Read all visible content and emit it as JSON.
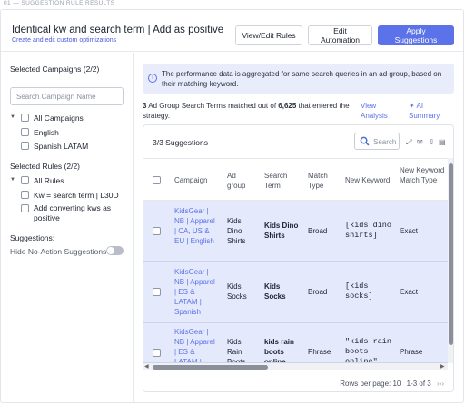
{
  "breadcrumb": "01 — SUGGESTION RULE RESULTS",
  "header": {
    "title": "Identical kw and search term | Add as positive",
    "subtitle": "Create and edit custom optimizations",
    "buttons": {
      "view_edit_rules": "View/Edit Rules",
      "edit_automation": "Edit Automation",
      "apply_suggestions": "Apply Suggestions"
    }
  },
  "sidebar": {
    "campaigns_heading": "Selected Campaigns (2/2)",
    "campaign_search_placeholder": "Search Campaign Name",
    "all_campaigns": "All Campaigns",
    "campaigns": [
      "English",
      "Spanish LATAM"
    ],
    "rules_heading": "Selected Rules (2/2)",
    "all_rules": "All Rules",
    "rules": [
      "Kw = search term | L30D",
      "Add converting kws as positive"
    ],
    "suggestions_heading": "Suggestions:",
    "hide_no_action": "Hide No-Action Suggestions"
  },
  "info_banner": "The performance data is aggregated for same search queries in an ad group, based on their matching keyword.",
  "match_summary": {
    "count": "3",
    "text_a": " Ad Group Search Terms matched out of ",
    "total": "6,625",
    "text_b": " that entered the strategy.",
    "view_analysis": "View Analysis",
    "ai_summary": "✦ AI Summary"
  },
  "table": {
    "title": "3/3 Suggestions",
    "search_placeholder": "Search",
    "columns": [
      "Campaign",
      "Ad group",
      "Search Term",
      "Match Type",
      "New Keyword",
      "New Keyword Match Type"
    ],
    "rows": [
      {
        "campaign": "KidsGear | NB | Apparel | CA, US & EU | English",
        "ad_group": "Kids Dino Shirts",
        "search_term": "Kids Dino Shirts",
        "match_type": "Broad",
        "new_keyword": "[kids dino shirts]",
        "new_match_type": "Exact"
      },
      {
        "campaign": "KidsGear | NB | Apparel | ES & LATAM | Spanish",
        "ad_group": "Kids Socks",
        "search_term": "Kids Socks",
        "match_type": "Broad",
        "new_keyword": "[kids socks]",
        "new_match_type": "Exact"
      },
      {
        "campaign": "KidsGear | NB | Apparel | ES & LATAM | Spanish",
        "ad_group": "Kids Rain Boots",
        "search_term": "kids rain boots online",
        "match_type": "Phrase",
        "new_keyword": "\"kids rain boots online\"",
        "new_match_type": "Phrase"
      }
    ],
    "rows_per_page_label": "Rows per page:",
    "rows_per_page": "10",
    "range": "1-3 of 3"
  },
  "colors": {
    "accent": "#5b72e8",
    "row_selected": "#e4e9fb",
    "info_bg": "#e8ecfb"
  },
  "icons": [
    "info-icon",
    "search-icon",
    "expand-icon",
    "email-icon",
    "download-icon",
    "save-icon",
    "chevron-down-icon",
    "first-page-icon",
    "last-page-icon"
  ]
}
